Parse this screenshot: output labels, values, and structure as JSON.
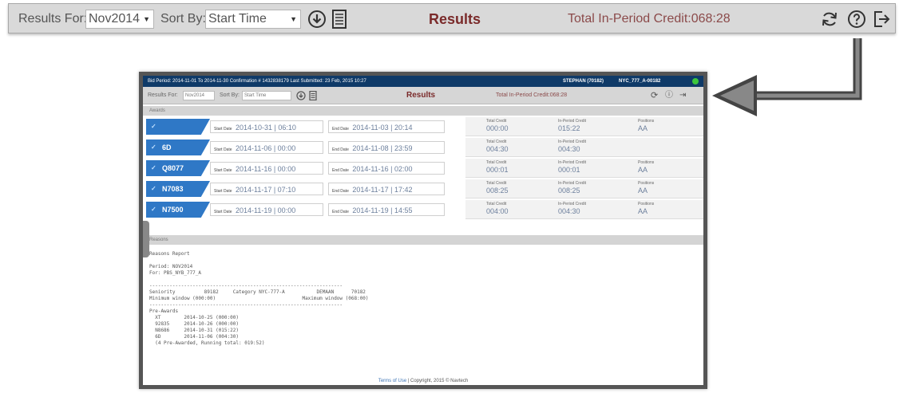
{
  "toolbar": {
    "results_for_label": "Results For:",
    "results_for_value": "Nov2014",
    "sort_by_label": "Sort By:",
    "sort_by_value": "Start Time",
    "title": "Results",
    "credit_label": "Total In-Period Credit:068:28",
    "icons": [
      "download-circle-icon",
      "document-icon",
      "refresh-icon",
      "help-icon",
      "logout-icon"
    ]
  },
  "shot": {
    "status_text": "Bid Period: 2014-11-01 To 2014-11-30 Confirmation # 1432838179 Last Submitted: 23 Feb, 2015 10:27",
    "status_user": "STEPHAN (70182)",
    "status_cat": "NYC_777_A-00182",
    "toolbar": {
      "results_for_label": "Results For:",
      "results_for_value": "Nov2014",
      "sort_by_label": "Sort By:",
      "sort_by_value": "Start Time",
      "title": "Results",
      "credit_label": "Total In-Period Credit:068:28"
    },
    "awards_label": "Awards",
    "reasons_label": "Reasons",
    "start_label": "Start Date",
    "end_label": "End Date",
    "total_credit_label": "Total Credit",
    "in_period_label": "In-Period Credit",
    "positions_label": "Positions",
    "awards": [
      {
        "tab": "",
        "start": "2014-10-31 | 06:10",
        "end": "2014-11-03 | 20:14",
        "total": "000:00",
        "in_period": "015:22",
        "position": "AA"
      },
      {
        "tab": "6D",
        "start": "2014-11-06 | 00:00",
        "end": "2014-11-08 | 23:59",
        "total": "004:30",
        "in_period": "004:30",
        "position": ""
      },
      {
        "tab": "Q8077",
        "start": "2014-11-16 | 00:00",
        "end": "2014-11-16 | 02:00",
        "total": "000:01",
        "in_period": "000:01",
        "position": "AA"
      },
      {
        "tab": "N7083",
        "start": "2014-11-17 | 07:10",
        "end": "2014-11-17 | 17:42",
        "total": "008:25",
        "in_period": "008:25",
        "position": "AA"
      },
      {
        "tab": "N7500",
        "start": "2014-11-19 | 00:00",
        "end": "2014-11-19 | 14:55",
        "total": "004:00",
        "in_period": "004:30",
        "position": "AA"
      }
    ],
    "report_text": "Reasons Report\n\nPeriod: NOV2014\nFor: PBS_NYB_777_A\n\n-------------------------------------------------------------------\nSeniority          89182     Category NYC-777-A           DEMAAN      70182\nMinimum window (000:00)                              Maximum window (068:00)\n-------------------------------------------------------------------\nPre-Awards\n  XT        2014-10-25 (000:00)\n  92835     2014-10-26 (000:00)\n  N8686     2014-10-31 (015:22)\n  6D        2014-11-06 (004:30)\n  (4 Pre-Awarded, Running total: 019:52)",
    "footer_link": "Terms of Use",
    "footer_text": " | Copyright, 2015 © Navtech"
  }
}
